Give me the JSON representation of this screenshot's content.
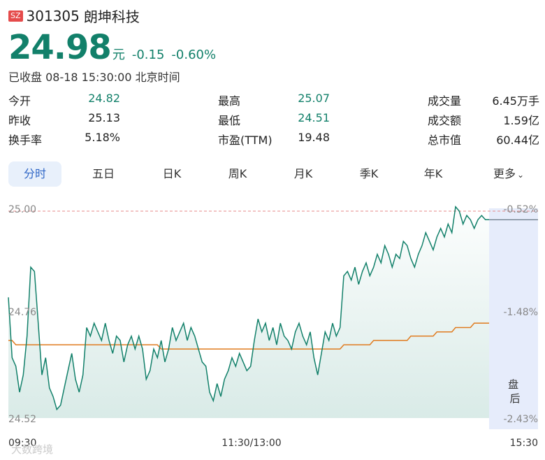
{
  "header": {
    "market": "SZ",
    "code": "301305",
    "name": "朗坤科技"
  },
  "quote": {
    "price": "24.98",
    "unit": "元",
    "change": "-0.15",
    "change_pct": "-0.60%",
    "status": "已收盘 08-18 15:30:00 北京时间"
  },
  "stats": [
    [
      {
        "label": "今开",
        "value": "24.82"
      },
      {
        "label": "最高",
        "value": "25.07"
      },
      {
        "label": "成交量",
        "value": "6.45万手"
      }
    ],
    [
      {
        "label": "昨收",
        "value": "25.13"
      },
      {
        "label": "最低",
        "value": "24.51"
      },
      {
        "label": "成交额",
        "value": "1.59亿"
      }
    ],
    [
      {
        "label": "换手率",
        "value": "5.18%"
      },
      {
        "label": "市盈(TTM)",
        "value": "19.48"
      },
      {
        "label": "总市值",
        "value": "60.44亿"
      }
    ]
  ],
  "tabs": [
    "分时",
    "五日",
    "日K",
    "周K",
    "月K",
    "季K",
    "年K",
    "更多"
  ],
  "active_tab": 0,
  "watermark": "大数跨境",
  "colors": {
    "down": "#12806a",
    "avg": "#e07b1f",
    "refline": "#e68a8a",
    "tab_active": "#2f66c6",
    "afterhours": "#e6ecfb"
  },
  "chart_data": {
    "type": "line",
    "title": "",
    "x_ticks": [
      "09:30",
      "11:30/13:00",
      "15:30"
    ],
    "y_ticks_left": [
      "25.00",
      "24.76",
      "24.52"
    ],
    "y_ticks_right": [
      "-0.52%",
      "-1.48%",
      "-2.43%"
    ],
    "ylim": [
      24.52,
      25.0
    ],
    "reference_price": 25.0,
    "after_hours_label": "盘后",
    "series": [
      {
        "values": [
          24.8,
          24.66,
          24.64,
          24.58,
          24.62,
          24.71,
          24.87,
          24.86,
          24.74,
          24.62,
          24.66,
          24.59,
          24.57,
          24.54,
          24.55,
          24.59,
          24.63,
          24.67,
          24.61,
          24.58,
          24.62,
          24.73,
          24.71,
          24.74,
          24.72,
          24.7,
          24.74,
          24.7,
          24.67,
          24.71,
          24.7,
          24.65,
          24.69,
          24.71,
          24.68,
          24.71,
          24.68,
          24.61,
          24.63,
          24.68,
          24.66,
          24.7,
          24.65,
          24.68,
          24.73,
          24.7,
          24.72,
          24.74,
          24.7,
          24.73,
          24.71,
          24.68,
          24.65,
          24.64,
          24.58,
          24.56,
          24.6,
          24.57,
          24.61,
          24.63,
          24.66,
          24.64,
          24.67,
          24.65,
          24.63,
          24.64,
          24.7,
          24.75,
          24.72,
          24.74,
          24.7,
          24.73,
          24.69,
          24.74,
          24.71,
          24.7,
          24.68,
          24.72,
          24.74,
          24.71,
          24.69,
          24.72,
          24.66,
          24.62,
          24.67,
          24.72,
          24.7,
          24.74,
          24.71,
          24.73,
          24.85,
          24.86,
          24.84,
          24.87,
          24.83,
          24.86,
          24.88,
          24.85,
          24.87,
          24.9,
          24.88,
          24.92,
          24.9,
          24.87,
          24.9,
          24.89,
          24.93,
          24.92,
          24.89,
          24.87,
          24.9,
          24.92,
          24.95,
          24.93,
          24.91,
          24.94,
          24.96,
          24.94,
          24.97,
          24.95,
          25.01,
          25.0,
          24.97,
          24.99,
          24.98,
          24.96,
          24.98,
          24.99,
          24.98,
          24.98
        ]
      },
      {
        "values": [
          24.7,
          24.7,
          24.69,
          24.69,
          24.69,
          24.69,
          24.69,
          24.69,
          24.69,
          24.69,
          24.69,
          24.69,
          24.69,
          24.69,
          24.69,
          24.69,
          24.69,
          24.69,
          24.69,
          24.69,
          24.69,
          24.69,
          24.69,
          24.69,
          24.69,
          24.69,
          24.69,
          24.69,
          24.69,
          24.69,
          24.69,
          24.69,
          24.69,
          24.69,
          24.69,
          24.69,
          24.69,
          24.69,
          24.69,
          24.69,
          24.69,
          24.68,
          24.68,
          24.68,
          24.68,
          24.68,
          24.68,
          24.68,
          24.68,
          24.68,
          24.68,
          24.68,
          24.68,
          24.68,
          24.68,
          24.68,
          24.68,
          24.68,
          24.68,
          24.68,
          24.68,
          24.68,
          24.68,
          24.68,
          24.68,
          24.68,
          24.68,
          24.68,
          24.68,
          24.68,
          24.68,
          24.68,
          24.68,
          24.68,
          24.68,
          24.68,
          24.68,
          24.68,
          24.68,
          24.68,
          24.68,
          24.68,
          24.68,
          24.68,
          24.68,
          24.68,
          24.68,
          24.68,
          24.68,
          24.68,
          24.69,
          24.69,
          24.69,
          24.69,
          24.69,
          24.69,
          24.69,
          24.69,
          24.7,
          24.7,
          24.7,
          24.7,
          24.7,
          24.7,
          24.7,
          24.7,
          24.7,
          24.7,
          24.71,
          24.71,
          24.71,
          24.71,
          24.71,
          24.71,
          24.71,
          24.72,
          24.72,
          24.72,
          24.72,
          24.72,
          24.73,
          24.73,
          24.73,
          24.73,
          24.73,
          24.74,
          24.74,
          24.74,
          24.74,
          24.74
        ]
      }
    ]
  }
}
